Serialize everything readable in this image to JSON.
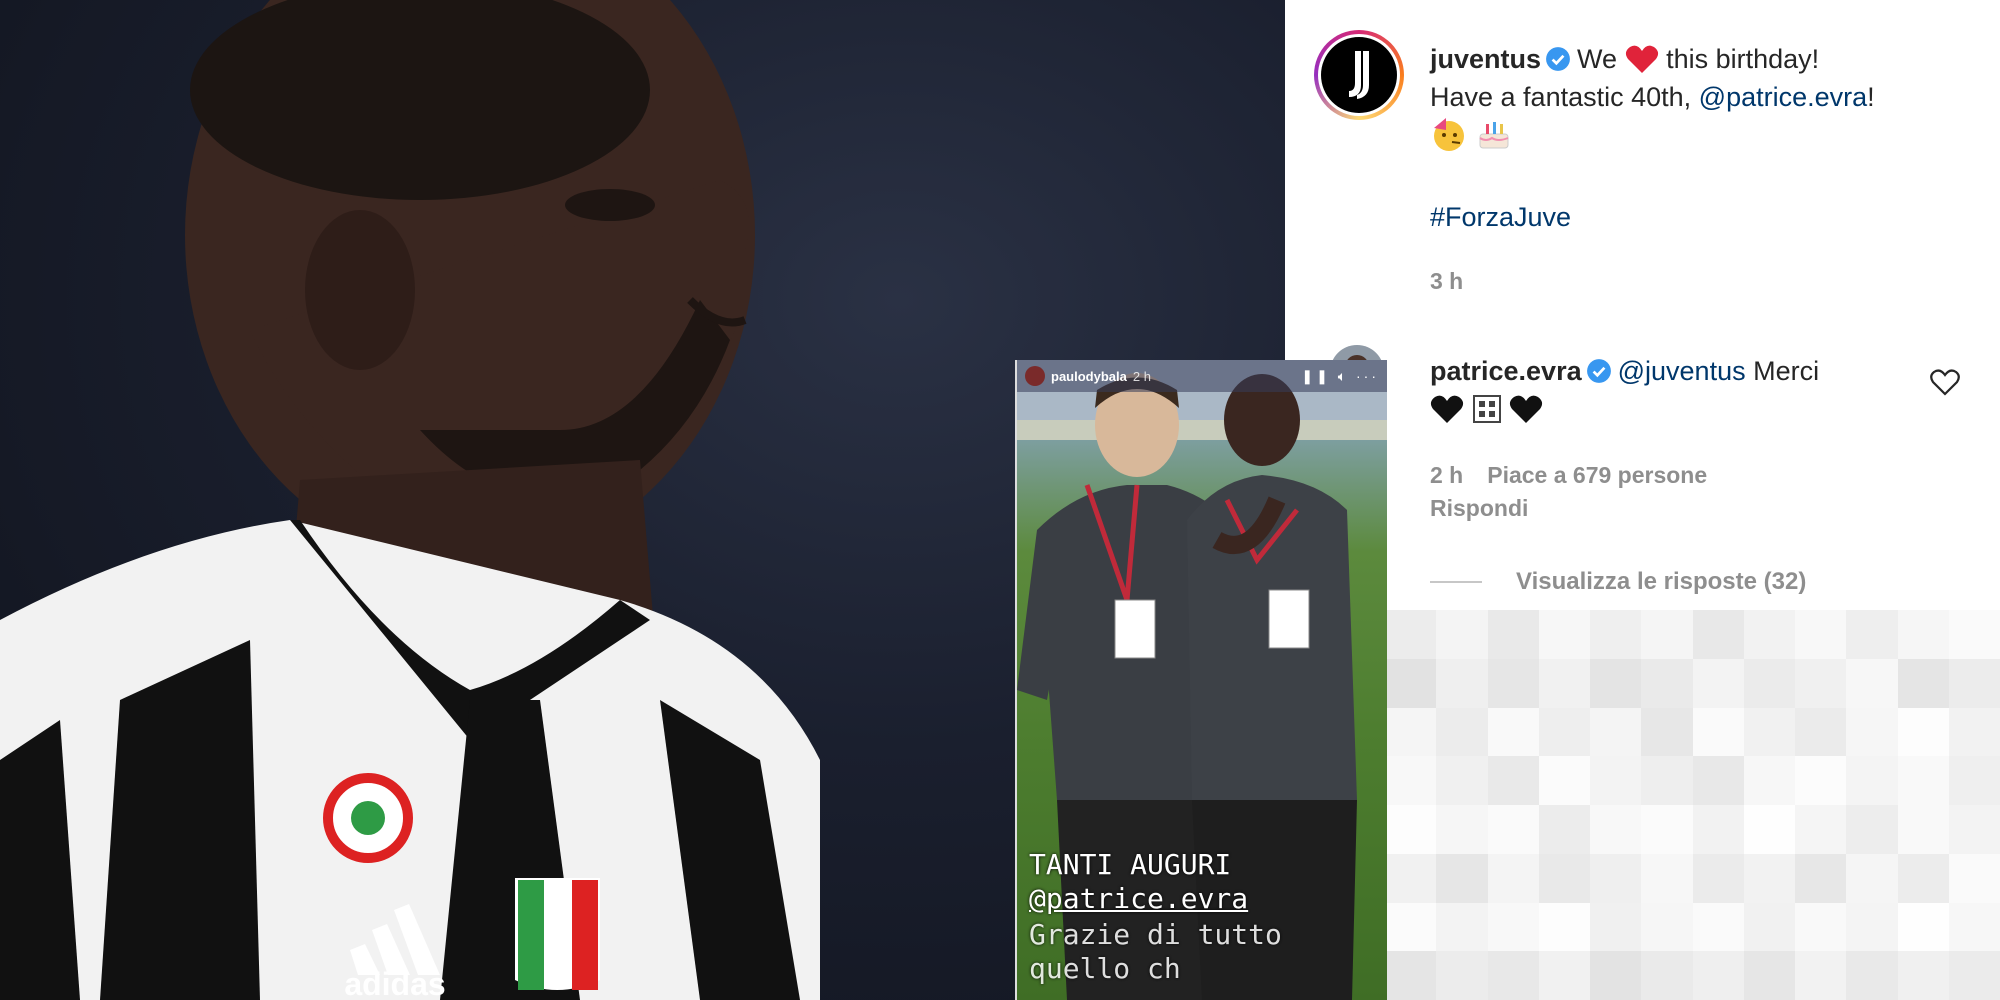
{
  "instagram": {
    "post": {
      "username": "juventus",
      "caption_line1": "We",
      "caption_line1_rest": "this birthday!",
      "caption_line2": "Have a fantastic 40th,",
      "mention": "@patrice.evra",
      "exclamation": "!",
      "hashtag": "#ForzaJuve",
      "time": "3 h"
    },
    "comment": {
      "username": "patrice.evra",
      "mention": "@juventus",
      "text": "Merci",
      "time": "2 h",
      "likes": "Piace a 679 persone",
      "reply_label": "Rispondi",
      "view_replies": "Visualizza le risposte (32)"
    },
    "colors": {
      "link": "#00376b",
      "verified": "#3897f0",
      "meta": "#8e8e8e"
    }
  },
  "story": {
    "username": "paulodybala",
    "time": "2 h",
    "text_line1": "TANTI AUGURI",
    "text_line2": "@patrice.evra",
    "text_line3": "Grazie di tutto quello ch"
  },
  "photo": {
    "kit_brand": "adidas"
  }
}
